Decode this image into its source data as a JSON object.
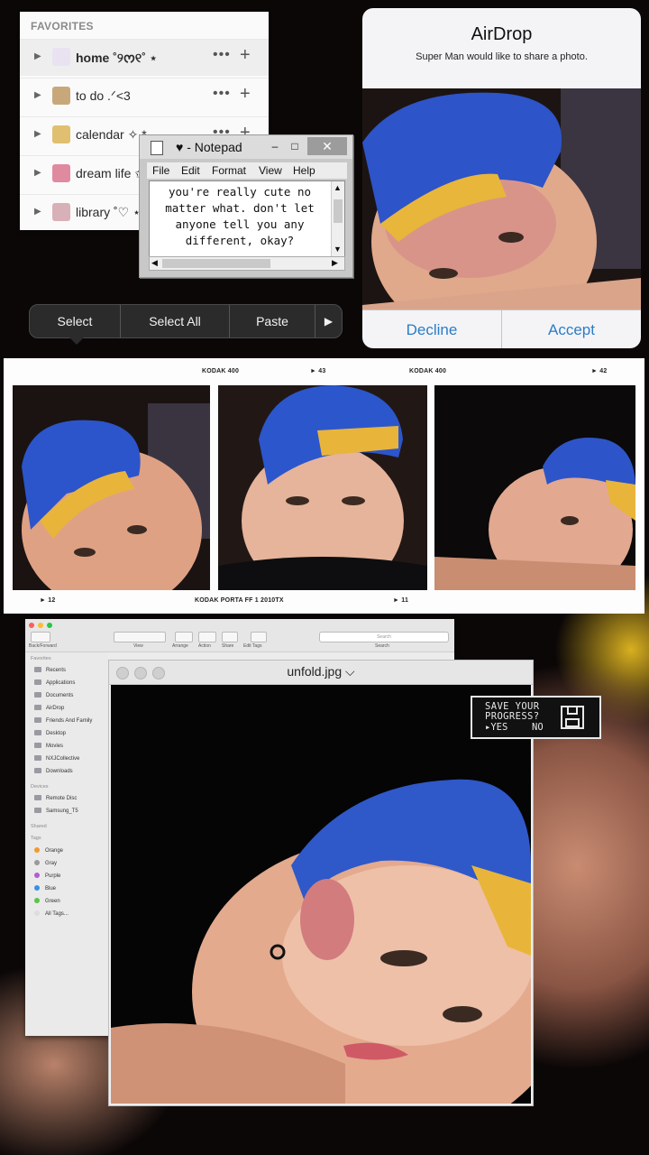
{
  "favorites": {
    "header": "FAVORITES",
    "items": [
      {
        "label": "home ˚୨ᰔ୧˚ ⋆",
        "emoji_color": "#e9e2f0",
        "selected": true
      },
      {
        "label": "to do .ᐟ<3",
        "emoji_color": "#c8a87a",
        "selected": false
      },
      {
        "label": "calendar ✧.*",
        "emoji_color": "#e0c070",
        "selected": false
      },
      {
        "label": "dream life ✩",
        "emoji_color": "#e08aa0",
        "selected": false
      },
      {
        "label": "library ˚♡ ⋆",
        "emoji_color": "#d8b0b8",
        "selected": false
      }
    ],
    "more_icon": "•••",
    "add_icon": "+"
  },
  "notepad": {
    "title": "♥ - Notepad",
    "minimize": "–",
    "maximize": "□",
    "close": "✕",
    "menu": [
      "File",
      "Edit",
      "Format",
      "View",
      "Help"
    ],
    "content": "you're really cute no\nmatter what.  don't let\nanyone tell you any\ndifferent, okay?",
    "scroll_up": "▲",
    "scroll_down": "▼",
    "scroll_left": "◀",
    "scroll_right": "▶"
  },
  "edit_menu": {
    "select": "Select",
    "select_all": "Select All",
    "paste": "Paste",
    "more": "▶"
  },
  "airdrop": {
    "title": "AirDrop",
    "subtitle": "Super Man would like to share a photo.",
    "decline": "Decline",
    "accept": "Accept",
    "button_color": "#2c7cc6"
  },
  "film_strip": {
    "top_labels": [
      "KODAK 400",
      "► 43",
      "KODAK 400",
      "► 42"
    ],
    "bottom_labels": [
      "► 12",
      "KODAK PORTA  FF 1  2010TX",
      "► 11"
    ]
  },
  "finder": {
    "toolbar_labels": [
      "Back/Forward",
      "View",
      "Arrange",
      "Action",
      "Share",
      "Edit Tags",
      "Search"
    ],
    "search_placeholder": "Search",
    "sections": {
      "favorites": "Favorites",
      "devices": "Devices",
      "shared": "Shared",
      "tags": "Tags"
    },
    "favorites": [
      "Recents",
      "Applications",
      "Documents",
      "AirDrop",
      "Friends And Family",
      "Desktop",
      "Movies",
      "NXJCollective",
      "Downloads"
    ],
    "devices": [
      "Remote Disc",
      "Samsung_T5"
    ],
    "tags": [
      {
        "name": "Orange",
        "color": "#f29a2e"
      },
      {
        "name": "Gray",
        "color": "#9a9a9a"
      },
      {
        "name": "Purple",
        "color": "#b45bd6"
      },
      {
        "name": "Blue",
        "color": "#3b8ee8"
      },
      {
        "name": "Green",
        "color": "#5cc44a"
      },
      {
        "name": "All Tags...",
        "color": "#dddddd"
      }
    ]
  },
  "preview": {
    "title": "unfold.jpg ⌵"
  },
  "save_dialog": {
    "line1": "SAVE YOUR",
    "line2": "PROGRESS?",
    "yes": "▸YES",
    "no": "NO",
    "icon": "floppy-disk-icon"
  }
}
